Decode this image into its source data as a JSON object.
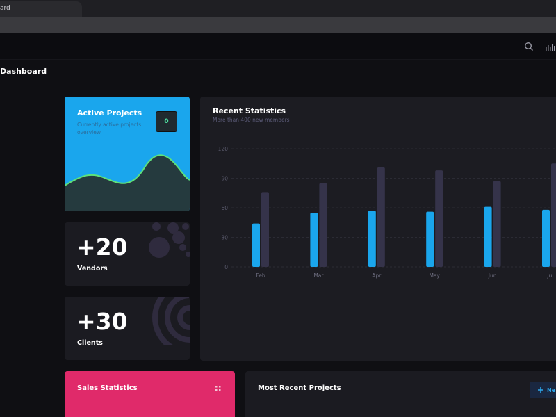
{
  "browser": {
    "tab_title": "ard"
  },
  "header": {
    "search_icon": "search-icon",
    "stats_icon": "bar-chart-icon"
  },
  "page": {
    "title": "Dashboard"
  },
  "active_projects": {
    "title": "Active Projects",
    "subtitle": "Currently active projects overview",
    "count": "0",
    "colors": {
      "bg": "#1aa6ed",
      "wave": "#253a3e",
      "wave_line": "#5ee27a"
    }
  },
  "vendors": {
    "value": "+20",
    "label": "Vendors"
  },
  "clients": {
    "value": "+30",
    "label": "Clients"
  },
  "recent_statistics": {
    "title": "Recent Statistics",
    "subtitle": "More than 400 new members"
  },
  "chart_data": {
    "type": "bar",
    "categories": [
      "Feb",
      "Mar",
      "Apr",
      "May",
      "Jun",
      "Jul"
    ],
    "series": [
      {
        "values": [
          44,
          55,
          57,
          56,
          61,
          58
        ],
        "color": "#1aa6ed"
      },
      {
        "values": [
          76,
          85,
          101,
          98,
          87,
          105
        ],
        "color": "#35334a"
      }
    ],
    "yticks": [
      0,
      30,
      60,
      90,
      120
    ],
    "ylim": [
      0,
      120
    ],
    "grid": true
  },
  "sales_statistics": {
    "title": "Sales Statistics",
    "colors": {
      "bg": "#e02a6a"
    }
  },
  "most_recent_projects": {
    "title": "Most Recent Projects",
    "button_label": "Ne"
  }
}
